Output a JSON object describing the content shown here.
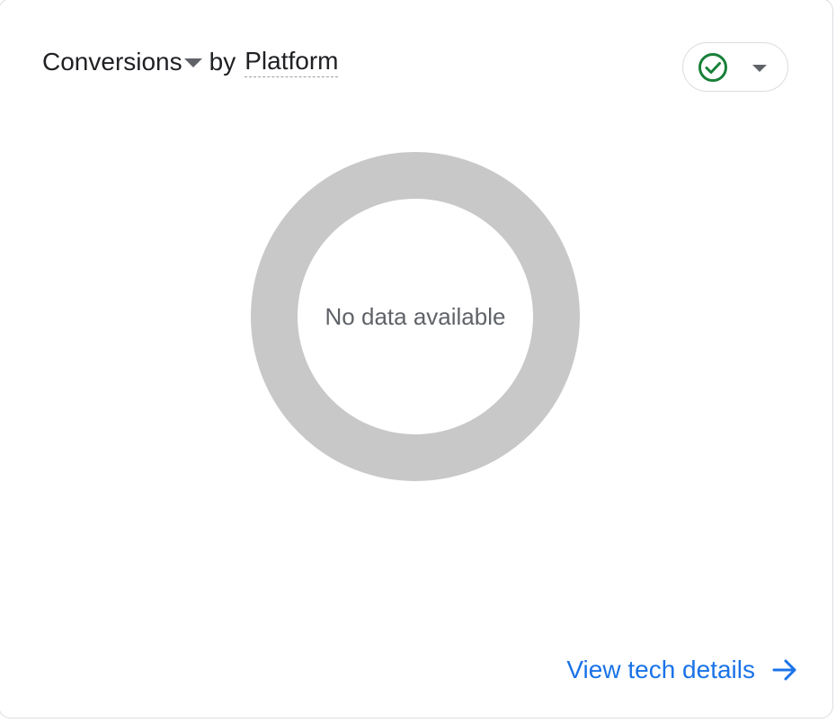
{
  "card": {
    "metric_label": "Conversions",
    "by_text": "by",
    "dimension_label": "Platform",
    "status_icon": "check-circle-icon",
    "status_color": "#188038"
  },
  "chart_data": {
    "type": "pie",
    "values": [],
    "empty_message": "No data available",
    "placeholder_color": "#c8c8c8"
  },
  "footer": {
    "link_label": "View tech details",
    "link_icon": "arrow-right-icon",
    "link_color": "#1a73e8"
  }
}
